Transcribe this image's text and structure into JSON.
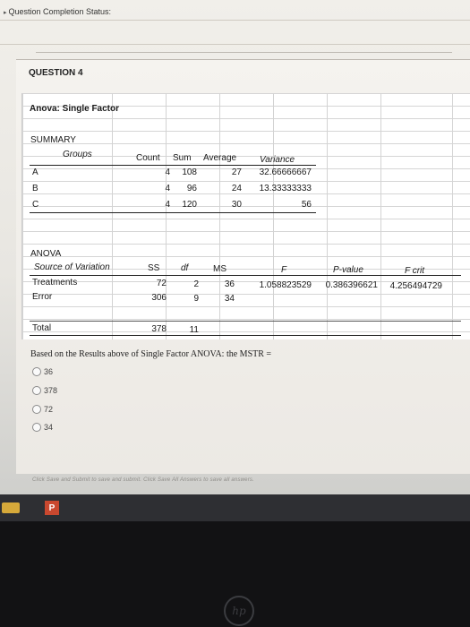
{
  "status_label": "Question Completion Status:",
  "question_label": "QUESTION 4",
  "sheet": {
    "anova_title": "Anova: Single Factor",
    "summary_label": "SUMMARY",
    "summary_headers": [
      "Groups",
      "Count",
      "Sum",
      "Average",
      "Variance"
    ],
    "summary_rows": [
      [
        "A",
        "4",
        "108",
        "27",
        "32.66666667"
      ],
      [
        "B",
        "4",
        "96",
        "24",
        "13.33333333"
      ],
      [
        "C",
        "4",
        "120",
        "30",
        "56"
      ]
    ],
    "anova_label": "ANOVA",
    "anova_headers": [
      "Source of Variation",
      "SS",
      "df",
      "MS",
      "F",
      "P-value",
      "F crit"
    ],
    "anova_rows": [
      [
        "Treatments",
        "72",
        "2",
        "36",
        "1.058823529",
        "0.386396621",
        "4.256494729"
      ],
      [
        "Error",
        "306",
        "9",
        "34",
        "",
        "",
        ""
      ]
    ],
    "total_row": [
      "Total",
      "378",
      "11"
    ]
  },
  "question_text": "Based on the Results above of Single Factor ANOVA: the MSTR =",
  "options": [
    "36",
    "378",
    "72",
    "34"
  ],
  "save_note": "Click Save and Submit to save and submit. Click Save All Answers to save all answers.",
  "taskbar": {
    "ppt_icon": "P"
  },
  "logo": "hp"
}
